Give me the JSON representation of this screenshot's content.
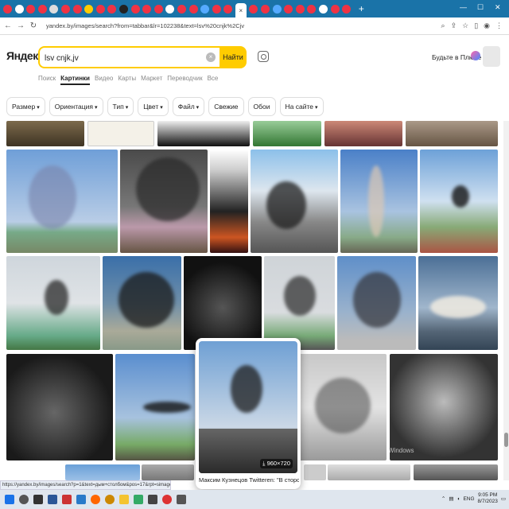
{
  "browser": {
    "url": "yandex.by/images/search?from=tabbar&lr=102238&text=lsv%20cnjk%2Cjv",
    "new_tab": "+",
    "tab_close": "×",
    "minimize": "—",
    "maximize": "☐",
    "close": "✕"
  },
  "header": {
    "logo": "Яндекс",
    "search_value": "lsv cnjk,jv",
    "search_button": "Найти",
    "plus_text": "Будьте в Плюсе",
    "tabs": [
      "Поиск",
      "Картинки",
      "Видео",
      "Карты",
      "Маркет",
      "Переводчик",
      "Все"
    ]
  },
  "filters": [
    "Размер",
    "Ориентация",
    "Тип",
    "Цвет",
    "Файл",
    "Свежие",
    "Обои",
    "На сайте"
  ],
  "preview": {
    "size": "960×720",
    "caption": "Максим Кузнецов Twitteren: \"В стороне"
  },
  "watermark": "Windows",
  "status_url": "https://yandex.by/images/search?p=1&text=дым+столбом&pos=17&rpt=simage&img_url=https%3A%2F%2Fpbs...",
  "system": {
    "time": "9:05 PM",
    "date": "8/7/2023",
    "lang": "ENG"
  },
  "colors": {
    "tab_strip": "#1a73a8",
    "search_accent": "#ffcc00",
    "logo_red": "#ff3333"
  }
}
